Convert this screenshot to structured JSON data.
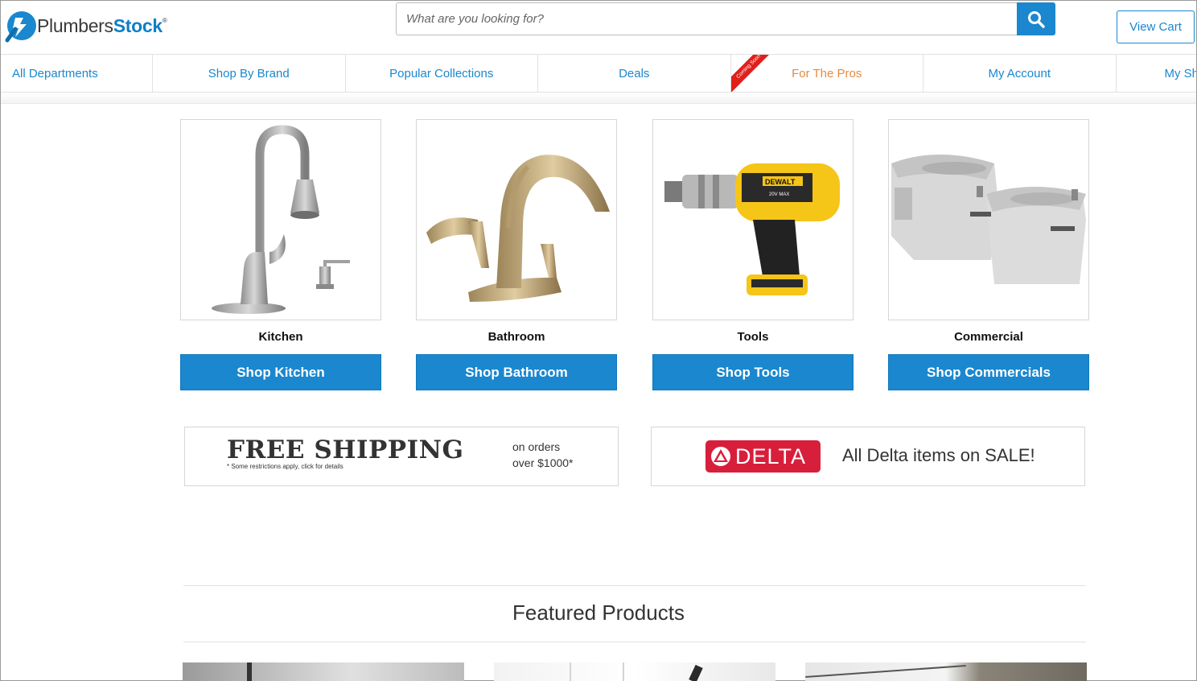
{
  "header": {
    "logo_part1": "Plumbers",
    "logo_part2": "Stock",
    "logo_reg": "®",
    "search_placeholder": "What are you looking for?",
    "view_cart": "View Cart"
  },
  "nav": {
    "items": [
      "All Departments",
      "Shop By Brand",
      "Popular Collections",
      "Deals",
      "For The Pros",
      "My Account",
      "My Sh"
    ],
    "ribbon": "Coming Soon"
  },
  "categories": [
    {
      "label": "Kitchen",
      "button": "Shop Kitchen"
    },
    {
      "label": "Bathroom",
      "button": "Shop Bathroom"
    },
    {
      "label": "Tools",
      "button": "Shop Tools"
    },
    {
      "label": "Commercial",
      "button": "Shop Commercials"
    }
  ],
  "drill_brand": {
    "name": "DEWALT",
    "voltage": "20V MAX"
  },
  "promo": {
    "shipping_title": "FREE SHIPPING",
    "shipping_note": "* Some restrictions apply, click for details",
    "shipping_line1": "on orders",
    "shipping_line2": "over $1000*",
    "delta_logo": "DELTA",
    "delta_text": "All Delta items on SALE!"
  },
  "featured": {
    "title": "Featured Products"
  },
  "colors": {
    "accent": "#1a87cf",
    "pros": "#e98a3d",
    "delta": "#d71f3b",
    "ribbon": "#e0201b"
  }
}
